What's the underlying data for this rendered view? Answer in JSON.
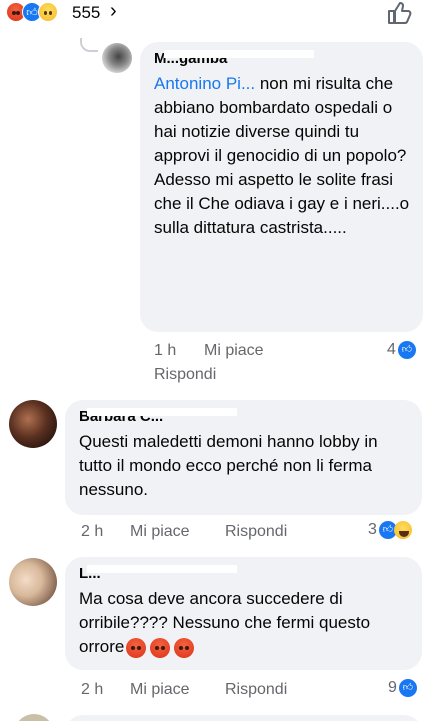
{
  "top_bar": {
    "reactions": [
      "angry-icon",
      "like-icon",
      "sad-icon"
    ],
    "count": "555",
    "chevron": "›"
  },
  "comments": [
    {
      "author": "M...gamba",
      "mention": "Antonino Pi...",
      "text": " non mi risulta che abbiano bombardato ospedali o hai notizie diverse quindi tu approvi il genocidio di un popolo?\nAdesso mi aspetto le solite frasi che il Che odiava i gay e i neri....o sulla dittatura castrista.....",
      "time": "1 h",
      "like": "Mi piace",
      "reply": "Rispondi",
      "reaction_count": "4"
    },
    {
      "author": "Barbara C...",
      "text": "Questi maledetti demoni hanno lobby in tutto il mondo ecco perché non li ferma nessuno.",
      "time": "2 h",
      "like": "Mi piace",
      "reply": "Rispondi",
      "reaction_count": "3"
    },
    {
      "author": "L...",
      "text": "Ma cosa deve ancora succedere di orribile???? Nessuno che fermi questo orrore",
      "time": "2 h",
      "like": "Mi piace",
      "reply": "Rispondi",
      "reaction_count": "9"
    }
  ],
  "colors": {
    "bubble": "#f0f2f5",
    "meta": "#65676b",
    "link": "#1877f2",
    "angry": "#e8442a"
  }
}
